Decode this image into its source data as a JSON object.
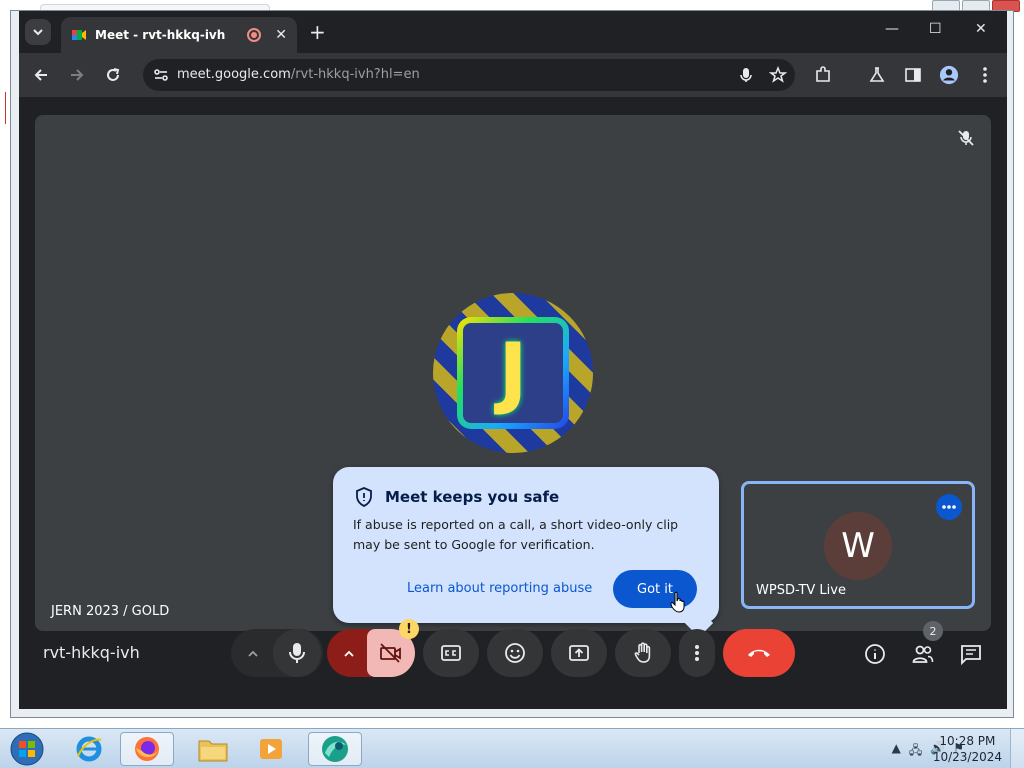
{
  "browser": {
    "tab_title": "Meet - rvt-hkkq-ivh",
    "tab_close": "✕",
    "new_tab": "+",
    "url_host": "meet.google.com",
    "url_path": "/rvt-hkkq-ivh?hl=en",
    "window_controls": {
      "minimize": "—",
      "maximize": "☐",
      "close": "✕"
    }
  },
  "meet": {
    "main_participant_name": "JERN 2023 / GOLD",
    "main_avatar_letter": "J",
    "self_tile": {
      "initial": "W",
      "name": "WPSD-TV Live"
    },
    "meeting_code": "rvt-hkkq-ivh",
    "participant_count": "2",
    "camera_warning": "!",
    "popup": {
      "title": "Meet keeps you safe",
      "body": "If abuse is reported on a call, a short video-only clip may be sent to Google for verification.",
      "link": "Learn about reporting abuse",
      "button": "Got it"
    }
  },
  "taskbar": {
    "time": "10:28 PM",
    "date": "10/23/2024"
  },
  "colors": {
    "accent": "#0b57d0",
    "end_call": "#ea4335",
    "cam_off_bg": "#f2b8b5",
    "cam_arrow_bg": "#8c1d18",
    "popup_bg": "#d3e3fd"
  }
}
